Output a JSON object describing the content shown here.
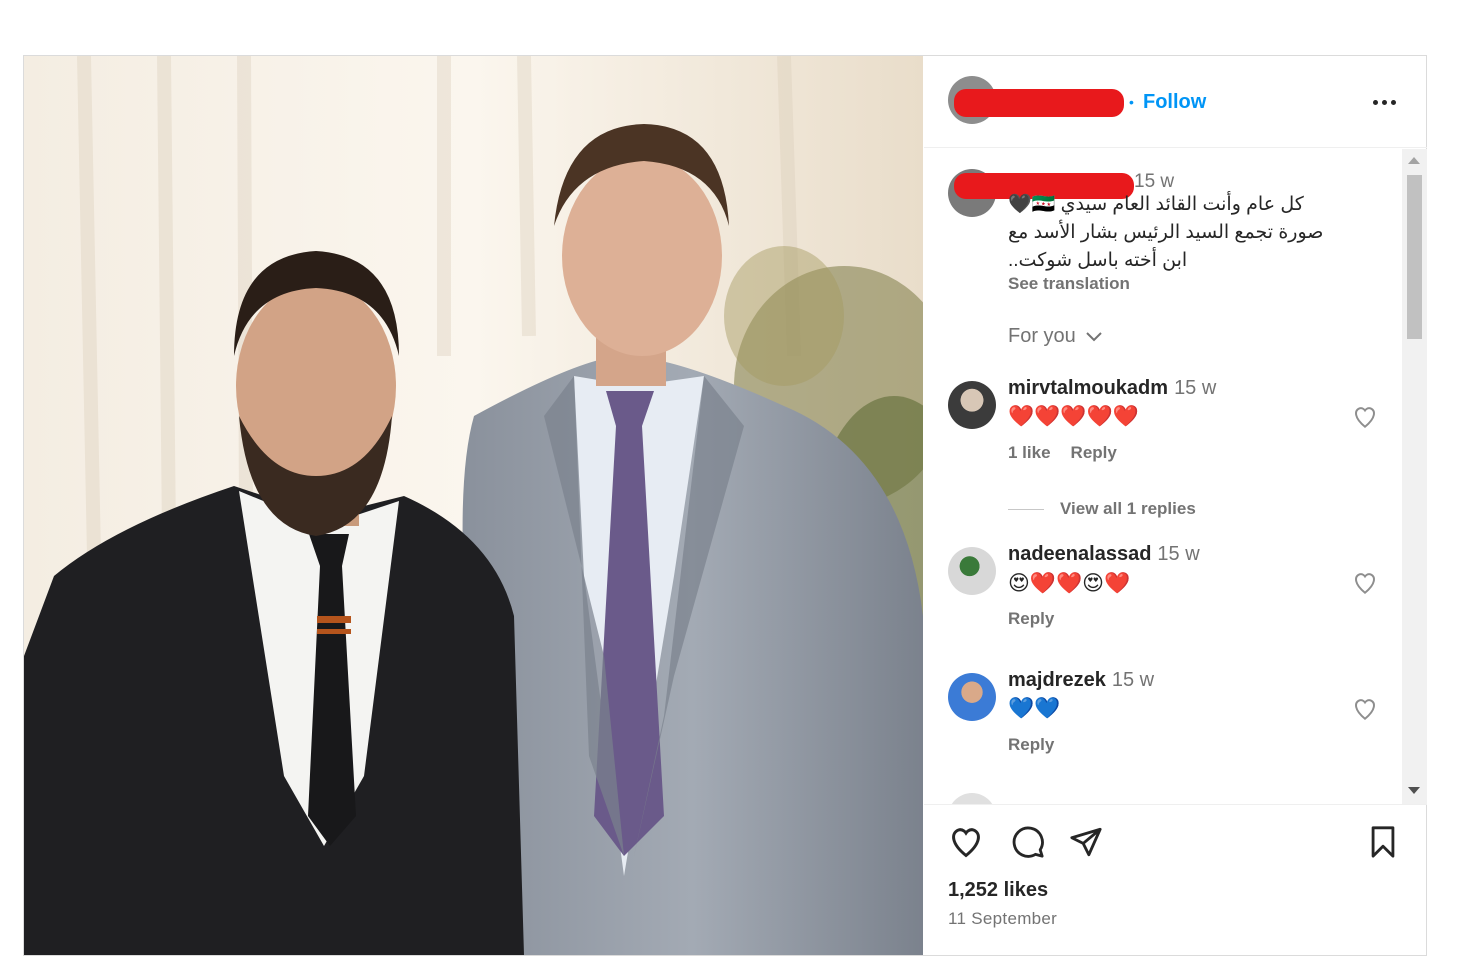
{
  "post": {
    "header": {
      "follow_label": "Follow",
      "dot": "•"
    },
    "caption": {
      "time": "15 w",
      "lines": [
        "كل عام وأنت القائد العام سيدي 🇸🇾🖤",
        "صورة تجمع السيد الرئيس بشار الأسد مع",
        "ابن أخته باسل شوكت.."
      ],
      "see_translation": "See translation"
    },
    "for_you_label": "For you",
    "comments": [
      {
        "username": "mirvtalmoukadm",
        "time": "15 w",
        "emoji": "❤️❤️❤️❤️❤️",
        "likes": "1 like",
        "reply": "Reply"
      },
      {
        "username": "nadeenalassad",
        "time": "15 w",
        "emoji": "😍❤️❤️😍❤️",
        "reply": "Reply"
      },
      {
        "username": "majdrezek",
        "time": "15 w",
        "emoji": "💙💙",
        "reply": "Reply"
      }
    ],
    "view_replies": "View all 1 replies",
    "likes": "1,252 likes",
    "date": "11 September"
  },
  "colors": {
    "accent": "#0095f6",
    "redaction": "#e8191c",
    "muted": "#737373"
  },
  "icons": [
    "like-heart-icon",
    "comment-bubble-icon",
    "share-send-icon",
    "bookmark-icon",
    "more-options-icon",
    "chevron-down-icon"
  ]
}
